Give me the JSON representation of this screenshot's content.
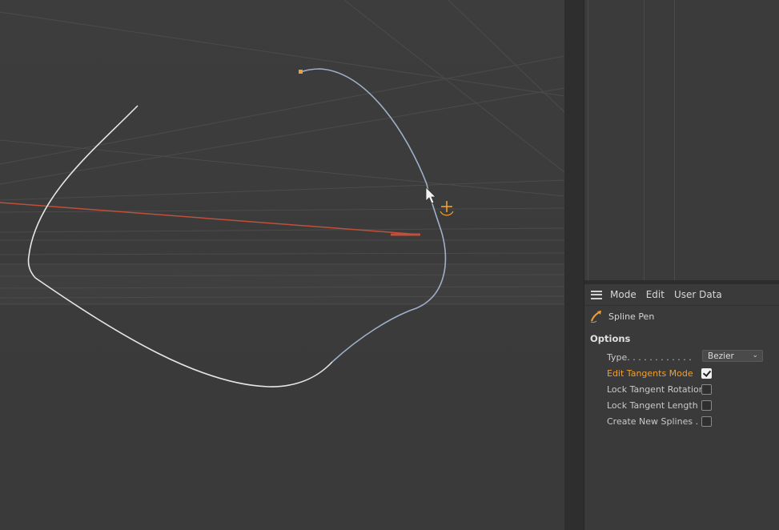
{
  "attributes": {
    "menu": {
      "mode": "Mode",
      "edit": "Edit",
      "user_data": "User Data"
    },
    "tool_name": "Spline Pen",
    "section": "Options",
    "options": {
      "type_label": "Type. . . . . . . . . . . .",
      "type_value": "Bezier",
      "edit_tangents_label": "Edit Tangents Mode",
      "lock_rotation_label": "Lock Tangent Rotation",
      "lock_length_label": "Lock Tangent Length",
      "create_new_label": "Create New Splines . ."
    },
    "checkboxes": {
      "edit_tangents": true,
      "lock_rotation": false,
      "lock_length": false,
      "create_new": false
    }
  },
  "colors": {
    "accent": "#f0a030",
    "spline_selected": "#9fb0c8",
    "spline": "#e6e6e6",
    "x_axis": "#c0503a"
  },
  "icons": {
    "cursor": "arrow-cursor-icon",
    "move_gizmo": "move-crosshair-icon",
    "tool": "spline-pen-icon",
    "menu": "hamburger-menu-icon"
  }
}
